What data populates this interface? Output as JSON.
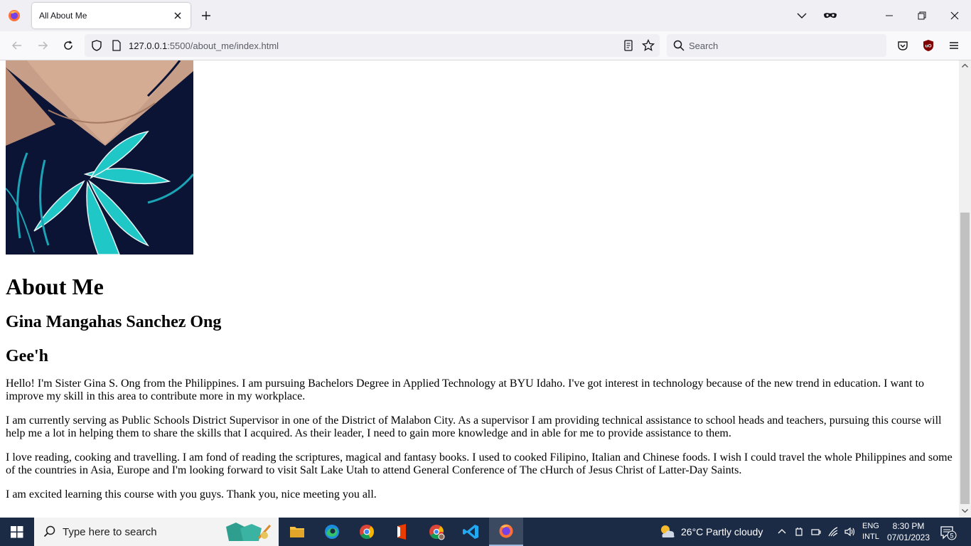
{
  "browser": {
    "tab_title": "All About Me",
    "url_host": "127.0.0.1",
    "url_rest": ":5500/about_me/index.html",
    "search_placeholder": "Search"
  },
  "page": {
    "heading": "About Me",
    "full_name": "Gina Mangahas Sanchez Ong",
    "nickname": "Gee'h",
    "paragraphs": [
      "Hello! I'm Sister Gina S. Ong from the Philippines. I am pursuing Bachelors Degree in Applied Technology at BYU Idaho. I've got interest in technology because of the new trend in education. I want to improve my skill in this area to contribute more in my workplace.",
      "I am currently serving as Public Schools District Supervisor in one of the District of Malabon City. As a supervisor I am providing technical assistance to school heads and teachers, pursuing this course will help me a lot in helping them to share the skills that I acquired. As their leader, I need to gain more knowledge and in able for me to provide assistance to them.",
      "I love reading, cooking and travelling. I am fond of reading the scriptures, magical and fantasy books. I used to cooked Filipino, Italian and Chinese foods. I wish I could travel the whole Philippines and some of the countries in Asia, Europe and I'm looking forward to visit Salt Lake Utah to attend General Conference of The cHurch of Jesus Christ of Latter-Day Saints.",
      "I am excited learning this course with you guys. Thank you, nice meeting you all."
    ]
  },
  "taskbar": {
    "search_placeholder": "Type here to search",
    "weather": "26°C  Partly cloudy",
    "lang_1": "ENG",
    "lang_2": "INTL",
    "time": "8:30 PM",
    "date": "07/01/2023",
    "notification_count": "5"
  },
  "colors": {
    "taskbar_bg": "#1b2b46",
    "chrome_bg": "#f0f0f4",
    "photo_dress": "#0c1436",
    "photo_teal": "#1fc7c7"
  }
}
